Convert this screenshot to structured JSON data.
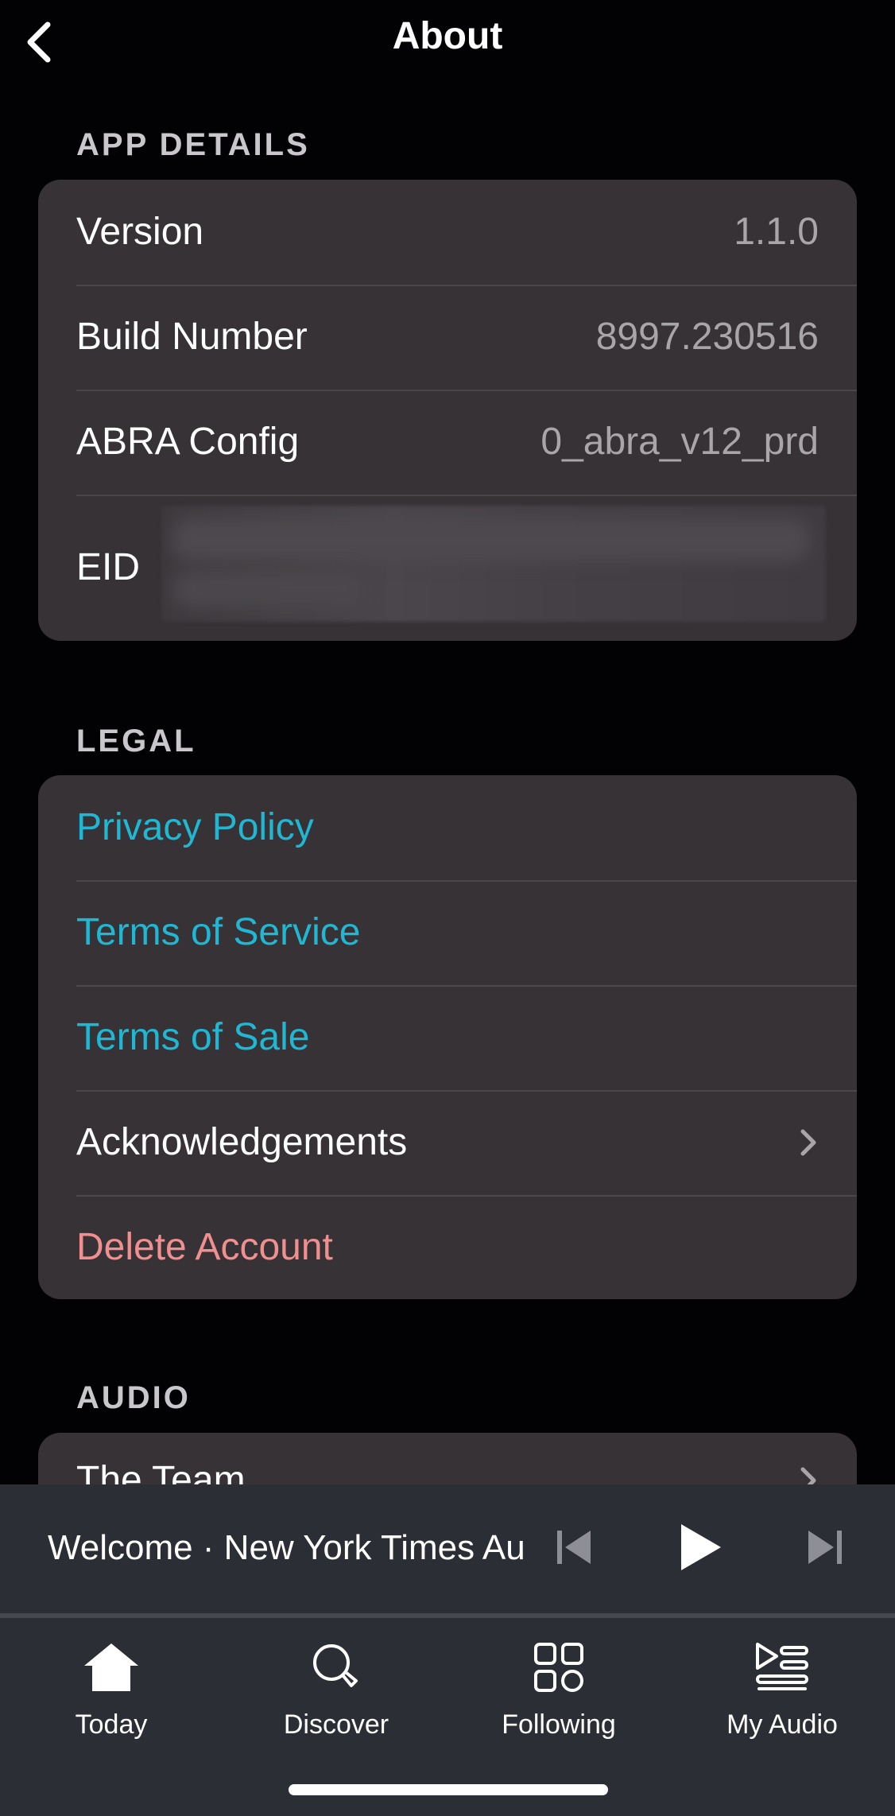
{
  "header": {
    "title": "About",
    "back_icon": "chevron-left-icon"
  },
  "app_details": {
    "title": "APP DETAILS",
    "rows": [
      {
        "label": "Version",
        "value": "1.1.0"
      },
      {
        "label": "Build Number",
        "value": "8997.230516"
      },
      {
        "label": "ABRA Config",
        "value": "0_abra_v12_prd"
      },
      {
        "label": "EID"
      }
    ]
  },
  "legal": {
    "title": "LEGAL",
    "rows": [
      {
        "label": "Privacy Policy"
      },
      {
        "label": "Terms of Service"
      },
      {
        "label": "Terms of Sale"
      },
      {
        "label": "Acknowledgements",
        "icon": "chevron-right-icon"
      },
      {
        "label": "Delete Account"
      }
    ]
  },
  "audio": {
    "title": "AUDIO",
    "rows": [
      {
        "label": "The Team",
        "icon": "chevron-right-icon"
      }
    ]
  },
  "player": {
    "now_playing": "Welcome  ·  New York Times Audio",
    "controls": [
      "previous-icon",
      "play-icon",
      "next-icon"
    ]
  },
  "tabs": [
    {
      "label": "Today",
      "icon": "home-icon",
      "active": true
    },
    {
      "label": "Discover",
      "icon": "search-icon"
    },
    {
      "label": "Following",
      "icon": "grid-icon"
    },
    {
      "label": "My Audio",
      "icon": "playlist-icon"
    }
  ],
  "colors": {
    "background": "#020103",
    "card": "#363236",
    "link": "#20b7d3",
    "danger": "#f08f8f",
    "secondary_text": "#a9a6aa",
    "bar": "#2c2e36"
  }
}
